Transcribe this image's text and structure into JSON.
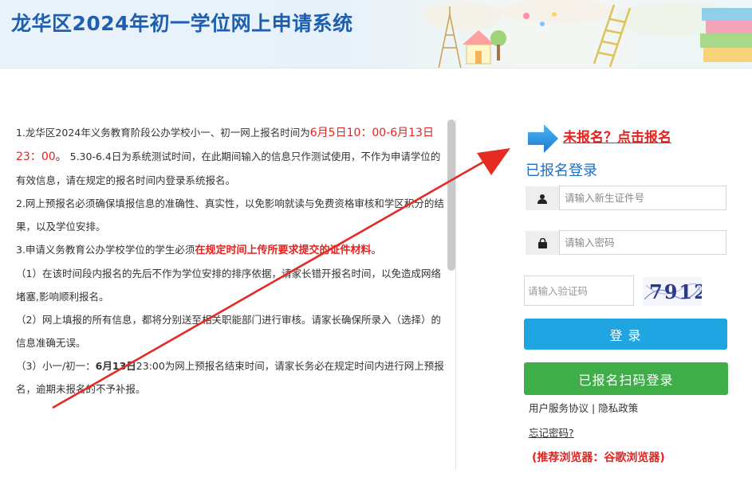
{
  "header": {
    "title": "龙华区2024年初一学位网上申请系统"
  },
  "notice": {
    "p1": {
      "a": "1.龙华区2024年义务教育阶段公办学校小一、初一网上报名时间为",
      "b": "6月5日10：00-6月13日23：00",
      "c": "。",
      "d": " 5.30-6.4日为系统测试时间，在此期间输入的信息只作测试使用，不作为申请学位的有效信息，请在规定的报名时间内登录系统报名。"
    },
    "p2": "2.网上预报名必须确保填报信息的准确性、真实性，以免影响就读与免费资格审核和学区积分的结果，以及学位安排。",
    "p3": {
      "a": "3.申请义务教育公办学校学位的学生必须",
      "b": "在规定时间上传所要求提交的证件材料",
      "c": "。"
    },
    "p4": "（1）在该时间段内报名的先后不作为学位安排的排序依据，请家长错开报名时间，以免造成网络堵塞,影响顺利报名。",
    "p5": "（2）网上填报的所有信息，都将分别送至相关职能部门进行审核。请家长确保所录入（选择）的信息准确无误。",
    "p6": {
      "a": "（3）小一/初一：",
      "b": "6月13日",
      "c": "23:00为网上预报名结束时间，请家长务必在规定时间内进行网上预报名，逾期未报名的不予补报。"
    }
  },
  "register": {
    "link_text": "未报名？点击报名"
  },
  "login": {
    "title": "已报名登录",
    "id_placeholder": "请输入新生证件号",
    "password_placeholder": "请输入密码",
    "captcha_placeholder": "请输入验证码",
    "captcha_text": "7912",
    "login_button": "登 录",
    "scan_button": "已报名扫码登录",
    "user_agreement": "用户服务协议",
    "separator": "|",
    "privacy": "隐私政策",
    "forgot_password": "忘记密码?",
    "browser_tip": "(推荐浏览器：谷歌浏览器)"
  },
  "icons": {
    "user": "user-icon",
    "lock": "lock-icon",
    "arrow": "blue-arrow-icon"
  },
  "colors": {
    "title_blue": "#1f5fb0",
    "accent_red": "#e4231f",
    "login_blue": "#1ea5e2",
    "scan_green": "#3fae49"
  }
}
